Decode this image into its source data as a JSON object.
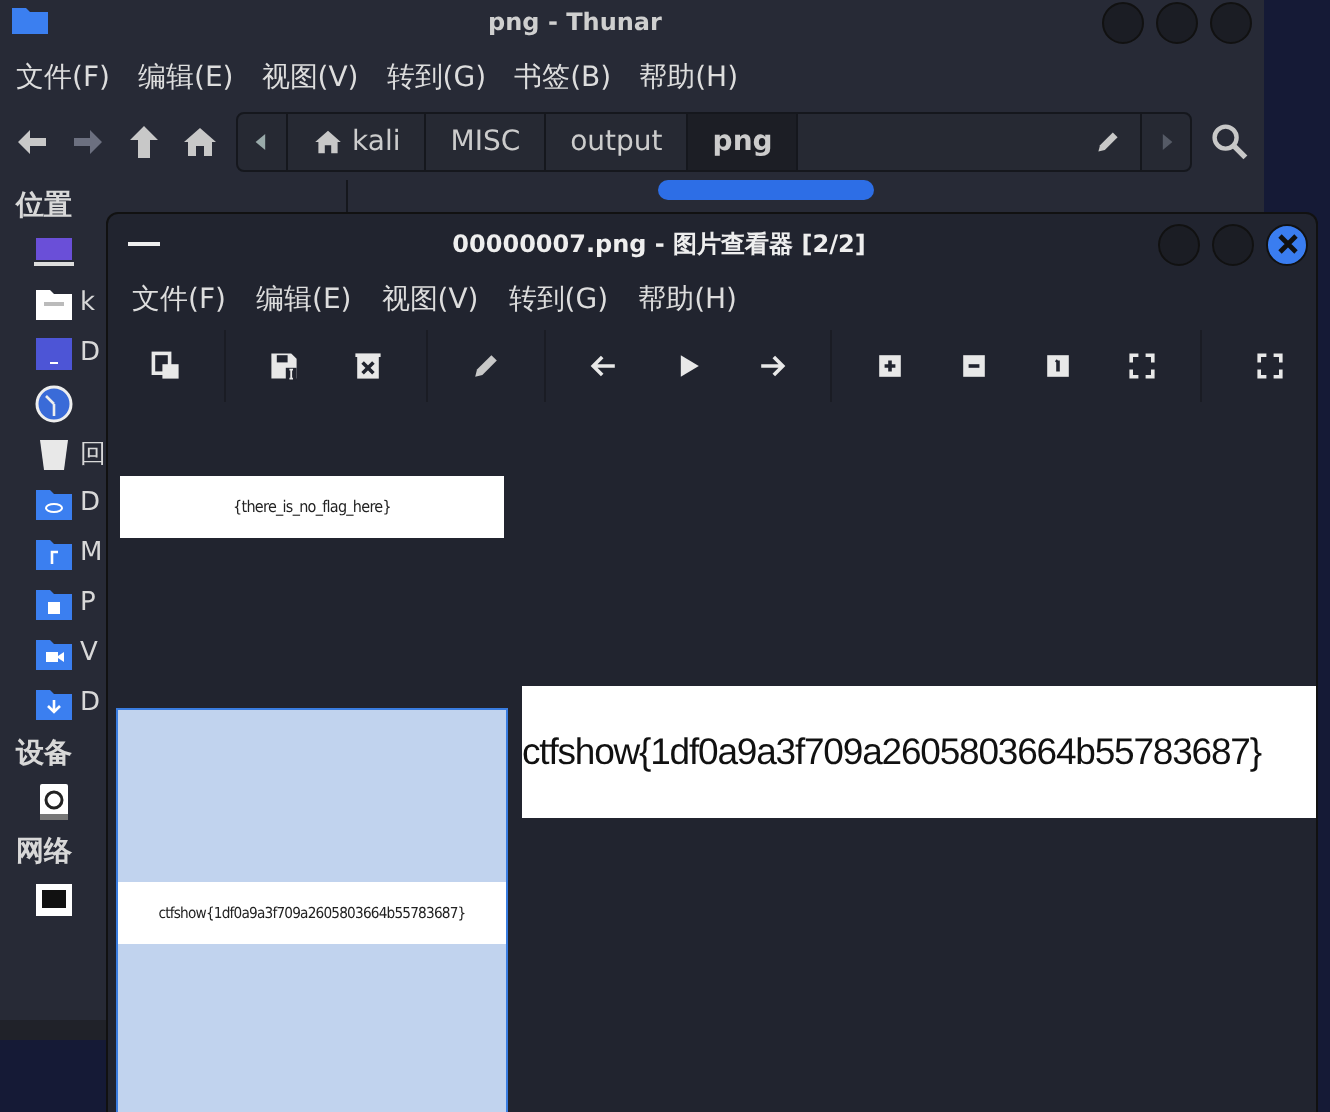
{
  "thunar": {
    "title": "png - Thunar",
    "menu": [
      "文件(F)",
      "编辑(E)",
      "视图(V)",
      "转到(G)",
      "书签(B)",
      "帮助(H)"
    ],
    "breadcrumbs": [
      {
        "label": "kali",
        "kind": "home",
        "selected": false
      },
      {
        "label": "MISC",
        "kind": "plain",
        "selected": false
      },
      {
        "label": "output",
        "kind": "plain",
        "selected": false
      },
      {
        "label": "png",
        "kind": "plain",
        "selected": true
      }
    ],
    "sidebar": [
      {
        "heading": "位置",
        "items": [
          {
            "kind": "computer"
          },
          {
            "kind": "home",
            "label": "k"
          },
          {
            "kind": "desktop",
            "label": "D"
          },
          {
            "kind": "recent"
          },
          {
            "kind": "trash",
            "label": "回"
          },
          {
            "kind": "share",
            "label": "D"
          },
          {
            "kind": "music",
            "label": "M"
          },
          {
            "kind": "pictures",
            "label": "P"
          },
          {
            "kind": "video",
            "label": "V"
          },
          {
            "kind": "download",
            "label": "D"
          }
        ]
      },
      {
        "heading": "设备",
        "items": [
          {
            "kind": "drive"
          }
        ]
      },
      {
        "heading": "网络",
        "items": [
          {
            "kind": "network"
          }
        ]
      }
    ]
  },
  "viewer": {
    "title": "00000007.png - 图片查看器 [2/2]",
    "menu": [
      "文件(F)",
      "编辑(E)",
      "视图(V)",
      "转到(G)",
      "帮助(H)"
    ],
    "thumbnails": [
      {
        "text": "{there_is_no_flag_here}",
        "selected": false
      },
      {
        "text": "ctfshow{1df0a9a3f709a2605803664b55783687}",
        "selected": true
      }
    ],
    "image_text": "ctfshow{1df0a9a3f709a2605803664b55783687}"
  }
}
